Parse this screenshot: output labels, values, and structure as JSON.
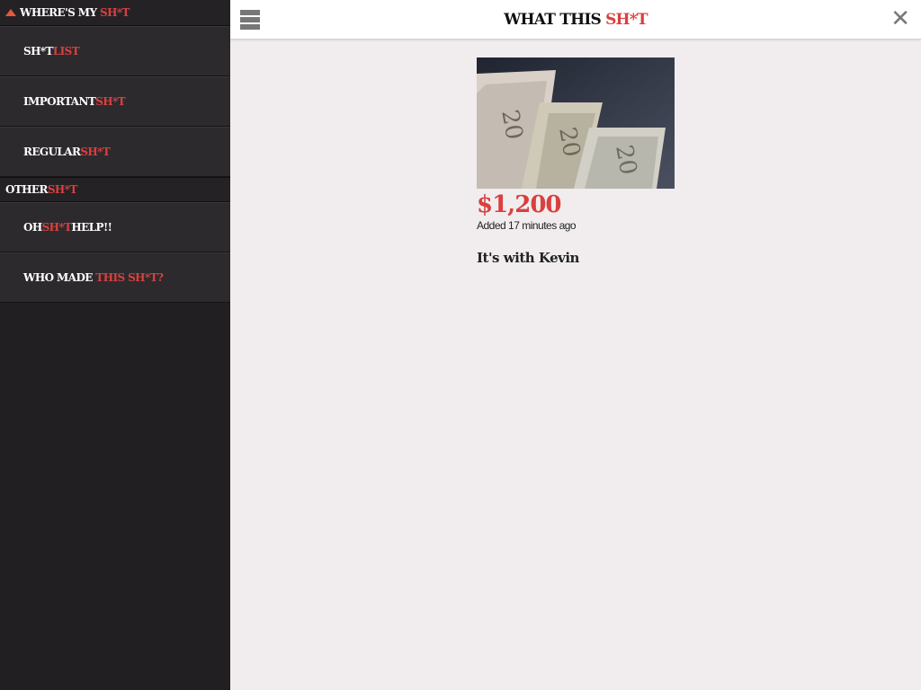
{
  "sidebar": {
    "header": {
      "white": "WHERE'S MY ",
      "red": "SH*T"
    },
    "items": [
      {
        "white": "SH*T",
        "red": "LIST"
      },
      {
        "white": "IMPORTANT",
        "red": "SH*T"
      },
      {
        "white": "REGULAR",
        "red": "SH*T"
      }
    ],
    "section": {
      "white": "OTHER",
      "red": "SH*T"
    },
    "other_items": [
      {
        "white": "OH",
        "red": "SH*T",
        "white2": "HELP!!"
      },
      {
        "white": "WHO MADE ",
        "red": "THIS SH*T?"
      }
    ]
  },
  "topbar": {
    "title_white": "WHAT THIS ",
    "title_red": "SH*T",
    "menu_icon": "hamburger-icon",
    "close_icon": "close-icon"
  },
  "item": {
    "image_alt": "Twenty dollar bills",
    "amount": "$1,200",
    "added": "Added 17 minutes ago",
    "note": "It's with Kevin"
  },
  "colors": {
    "accent": "#d9403f",
    "sidebar_bg": "#221f22",
    "content_bg": "#f1edee"
  }
}
